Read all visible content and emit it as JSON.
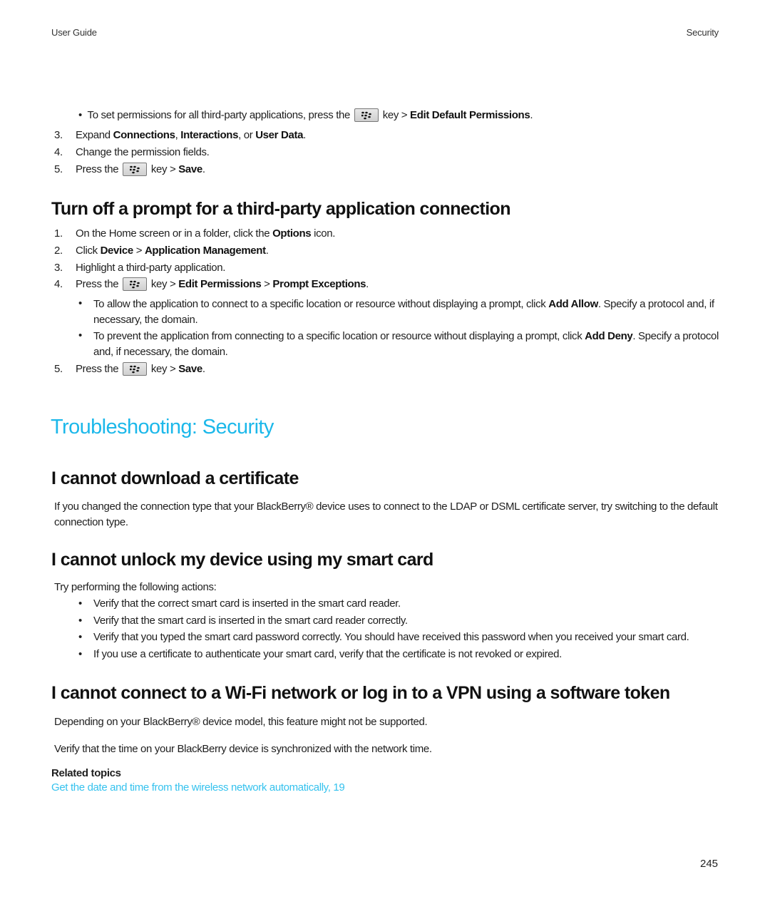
{
  "header": {
    "left": "User Guide",
    "right": "Security"
  },
  "accent_color": "#1cb8ea",
  "icons": {
    "menu_key": "blackberry-menu-key-icon"
  },
  "top_section": {
    "bullet": {
      "pre": "To set permissions for all third-party applications, press the",
      "mid": "key >",
      "bold": "Edit Default Permissions",
      "post": "."
    },
    "steps": [
      {
        "num": "3.",
        "pre": "Expand",
        "b1": "Connections",
        "s1": ",",
        "b2": "Interactions",
        "s2": ", or",
        "b3": "User Data",
        "post": "."
      },
      {
        "num": "4.",
        "text": "Change the permission fields."
      },
      {
        "num": "5.",
        "pre": "Press the",
        "mid": "key >",
        "bold": "Save",
        "post": "."
      }
    ]
  },
  "prompt_section": {
    "title": "Turn off a prompt for a third-party application connection",
    "steps": [
      {
        "num": "1.",
        "pre": "On the Home screen or in a folder, click the",
        "bold": "Options",
        "post": "icon."
      },
      {
        "num": "2.",
        "pre": "Click",
        "b1": "Device",
        "sep": ">",
        "b2": "Application Management",
        "post": "."
      },
      {
        "num": "3.",
        "text": "Highlight a third-party application."
      },
      {
        "num": "4.",
        "pre": "Press the",
        "mid": "key >",
        "b1": "Edit Permissions",
        "sep": ">",
        "b2": "Prompt Exceptions",
        "post": "."
      },
      {
        "num": "5.",
        "pre": "Press the",
        "mid": "key >",
        "bold": "Save",
        "post": "."
      }
    ],
    "bullets": [
      {
        "pre": "To allow the application to connect to a specific location or resource without displaying a prompt, click",
        "bold": "Add Allow",
        "post": ". Specify a protocol and, if necessary, the domain."
      },
      {
        "pre": "To prevent the application from connecting to a specific location or resource without displaying a prompt, click",
        "bold": "Add Deny",
        "post": ". Specify a protocol and, if necessary, the domain."
      }
    ]
  },
  "troubleshooting": {
    "title": "Troubleshooting: Security",
    "cert": {
      "title": "I cannot download a certificate",
      "body": "If you changed the connection type that your BlackBerry® device uses to connect to the LDAP or DSML certificate server, try switching to the default connection type."
    },
    "smartcard": {
      "title": "I cannot unlock my device using my smart card",
      "intro": "Try performing the following actions:",
      "bullets": [
        "Verify that the correct smart card is inserted in the smart card reader.",
        "Verify that the smart card is inserted in the smart card reader correctly.",
        "Verify that you typed the smart card password correctly. You should have received this password when you received your smart card.",
        "If you use a certificate to authenticate your smart card, verify that the certificate is not revoked or expired."
      ]
    },
    "wifi": {
      "title": "I cannot connect to a Wi-Fi network or log in to a VPN using a software token",
      "p1": "Depending on your BlackBerry® device model, this feature might not be supported.",
      "p2": "Verify that the time on your BlackBerry device is synchronized with the network time.",
      "related_label": "Related topics",
      "related_link": "Get the date and time from the wireless network automatically, 19"
    }
  },
  "page_number": "245"
}
